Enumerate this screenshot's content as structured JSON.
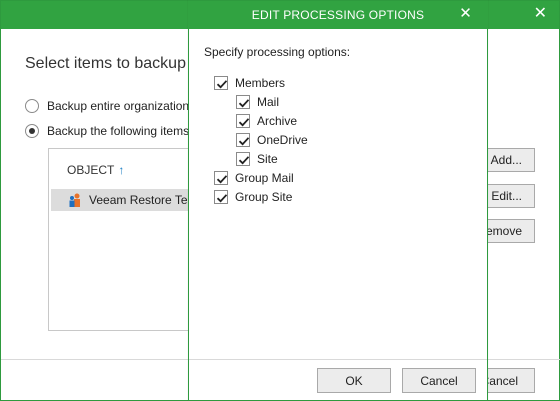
{
  "background": {
    "close_glyph": "✕",
    "heading": "Select items to backup",
    "radio_entire": "Backup entire organization",
    "radio_following": "Backup the following items:",
    "object_header": "OBJECT",
    "sort_arrow": "↑",
    "object_row": "Veeam Restore Test",
    "btn_add": "Add...",
    "btn_edit": "Edit...",
    "btn_remove": "Remove",
    "btn_cancel": "Cancel"
  },
  "dialog": {
    "title": "EDIT PROCESSING OPTIONS",
    "close_glyph": "✕",
    "instruction": "Specify processing options:",
    "options": {
      "members": "Members",
      "mail": "Mail",
      "archive": "Archive",
      "onedrive": "OneDrive",
      "site": "Site",
      "group_mail": "Group Mail",
      "group_site": "Group Site"
    },
    "ok_label": "OK",
    "cancel_label": "Cancel"
  },
  "colors": {
    "title_bar": "#31a341",
    "border": "#2e9a3e"
  },
  "icons": [
    "close-icon",
    "sort-up-icon",
    "organization-icon",
    "checkmark-icon",
    "radio-icon"
  ]
}
